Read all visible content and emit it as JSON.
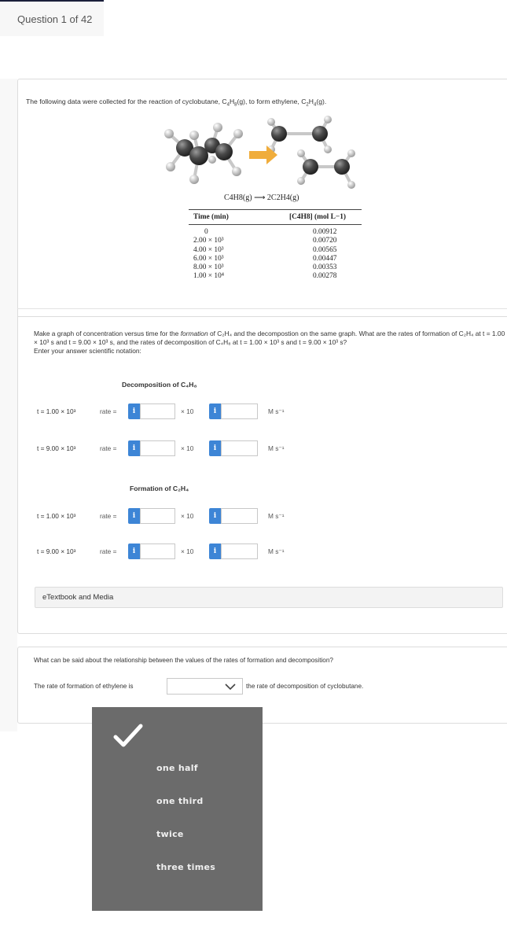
{
  "header": {
    "question_counter": "Question 1 of 42"
  },
  "problem": {
    "intro": {
      "pre": "The following data were collected for the reaction of cyclobutane, C",
      "s1": "4",
      "m1": "H",
      "s2": "8",
      "mid": "(g), to form ethylene, C",
      "s3": "2",
      "m2": "H",
      "s4": "4",
      "end": "(g)."
    },
    "figure": {
      "icon": "molecule-reaction-image",
      "arrow_color": "#f0ad3c"
    },
    "equation": {
      "reactant": "C4H8(g)",
      "arrow": "⟶",
      "product": "2C2H4(g)"
    },
    "table": {
      "headers": [
        "Time (min)",
        "[C4H8] (mol L−1)"
      ],
      "rows": [
        [
          "0",
          "0.00912"
        ],
        [
          "2.00 × 10³",
          "0.00720"
        ],
        [
          "4.00 × 10³",
          "0.00565"
        ],
        [
          "6.00 × 10³",
          "0.00447"
        ],
        [
          "8.00 × 10³",
          "0.00353"
        ],
        [
          "1.00 × 10⁴",
          "0.00278"
        ]
      ]
    },
    "prompt": {
      "line1": "Make a graph of concentration versus time for the",
      "formation_word": "formation",
      "line1b": "of C₂H₄ and the decompostion on the same graph. What are the rates of formation of C₂H₄ at t = 1.00 × 10³ s and t = 9.00 × 10³ s, and the rates of decomposition of C₄H₈ at t = 1.00 × 10³ s and t = 9.00 × 10³ s?",
      "instruction": "Enter your answer scientific notation:"
    },
    "decomposition": {
      "title": "Decomposition of C₄H₈",
      "rows": [
        {
          "t_label": "t = 1.00 × 10³",
          "rate_label": "rate =",
          "mantissa": "",
          "times": "× 10",
          "exponent": "",
          "unit": "M s⁻¹"
        },
        {
          "t_label": "t = 9.00 × 10³",
          "rate_label": "rate =",
          "mantissa": "",
          "times": "× 10",
          "exponent": "",
          "unit": "M s⁻¹"
        }
      ]
    },
    "formation": {
      "title": "Formation of C₂H₄",
      "rows": [
        {
          "t_label": "t = 1.00 × 10³",
          "rate_label": "rate =",
          "mantissa": "",
          "times": "× 10",
          "exponent": "",
          "unit": "M s⁻¹"
        },
        {
          "t_label": "t = 9.00 × 10³",
          "rate_label": "rate =",
          "mantissa": "",
          "times": "× 10",
          "exponent": "",
          "unit": "M s⁻¹"
        }
      ]
    },
    "info_button_label": "i",
    "etextbook_label": "eTextbook and Media"
  },
  "part2": {
    "question": "What can be said about the relationship between the values of the rates of formation and decomposition?",
    "sentence_before": "The rate of formation of ethylene is",
    "selected_value": "",
    "sentence_after": "the rate of decomposition of cyclobutane.",
    "dropdown_options": [
      "one half",
      "one third",
      "twice",
      "three times"
    ]
  },
  "colors": {
    "info_button": "#3d85d6",
    "dropdown_bg": "#6b6b6b"
  }
}
